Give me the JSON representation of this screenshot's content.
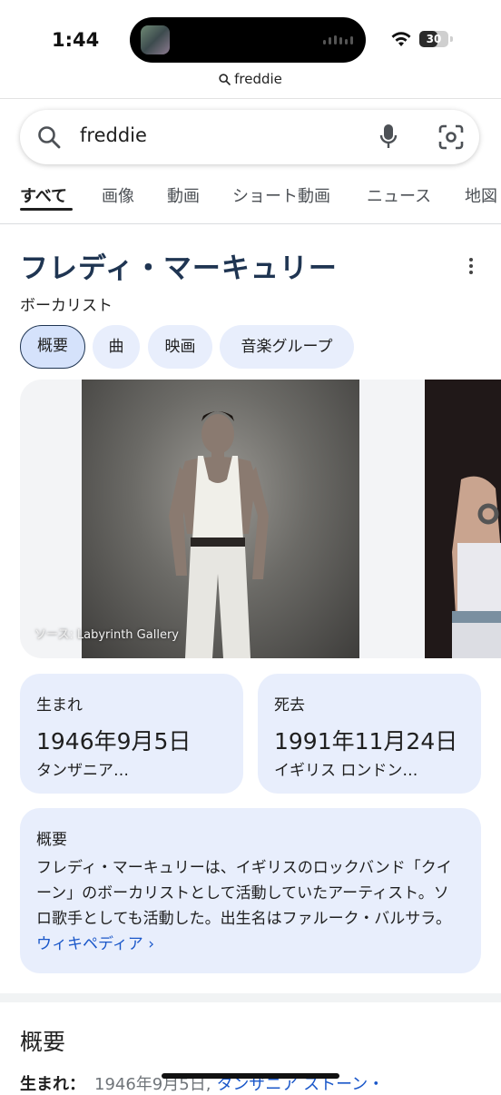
{
  "status_bar": {
    "time": "1:44",
    "battery": "30"
  },
  "url_bar": {
    "text": "freddie"
  },
  "search": {
    "query": "freddie"
  },
  "tabs": [
    {
      "label": "すべて",
      "active": true
    },
    {
      "label": "画像"
    },
    {
      "label": "動画"
    },
    {
      "label": "ショート動画"
    },
    {
      "label": "ニュース"
    },
    {
      "label": "地図"
    }
  ],
  "knowledge_panel": {
    "title": "フレディ・マーキュリー",
    "subtitle": "ボーカリスト",
    "chips": [
      "概要",
      "曲",
      "映画",
      "音楽グループ"
    ],
    "image_source": "ソース: Labyrinth Gallery",
    "born": {
      "label": "生まれ",
      "date": "1946年9月5日",
      "place": "タンザニア…"
    },
    "died": {
      "label": "死去",
      "date": "1991年11月24日",
      "place": "イギリス ロンドン…"
    },
    "summary": {
      "label": "概要",
      "text": "フレディ・マーキュリーは、イギリスのロックバンド「クイーン」のボーカリストとして活動していたアーティスト。ソロ歌手としても活動した。出生名はファルーク・バルサラ。",
      "link": "ウィキペディア ›"
    }
  },
  "overview_section": {
    "title": "概要",
    "born_label": "生まれ：",
    "born_value": "1946年9月5日,",
    "born_link": "タンザニア ストーン・"
  },
  "colors": {
    "title_navy": "#1f3552",
    "chip_bg": "#e8eefc",
    "link_blue": "#1a57c9"
  }
}
